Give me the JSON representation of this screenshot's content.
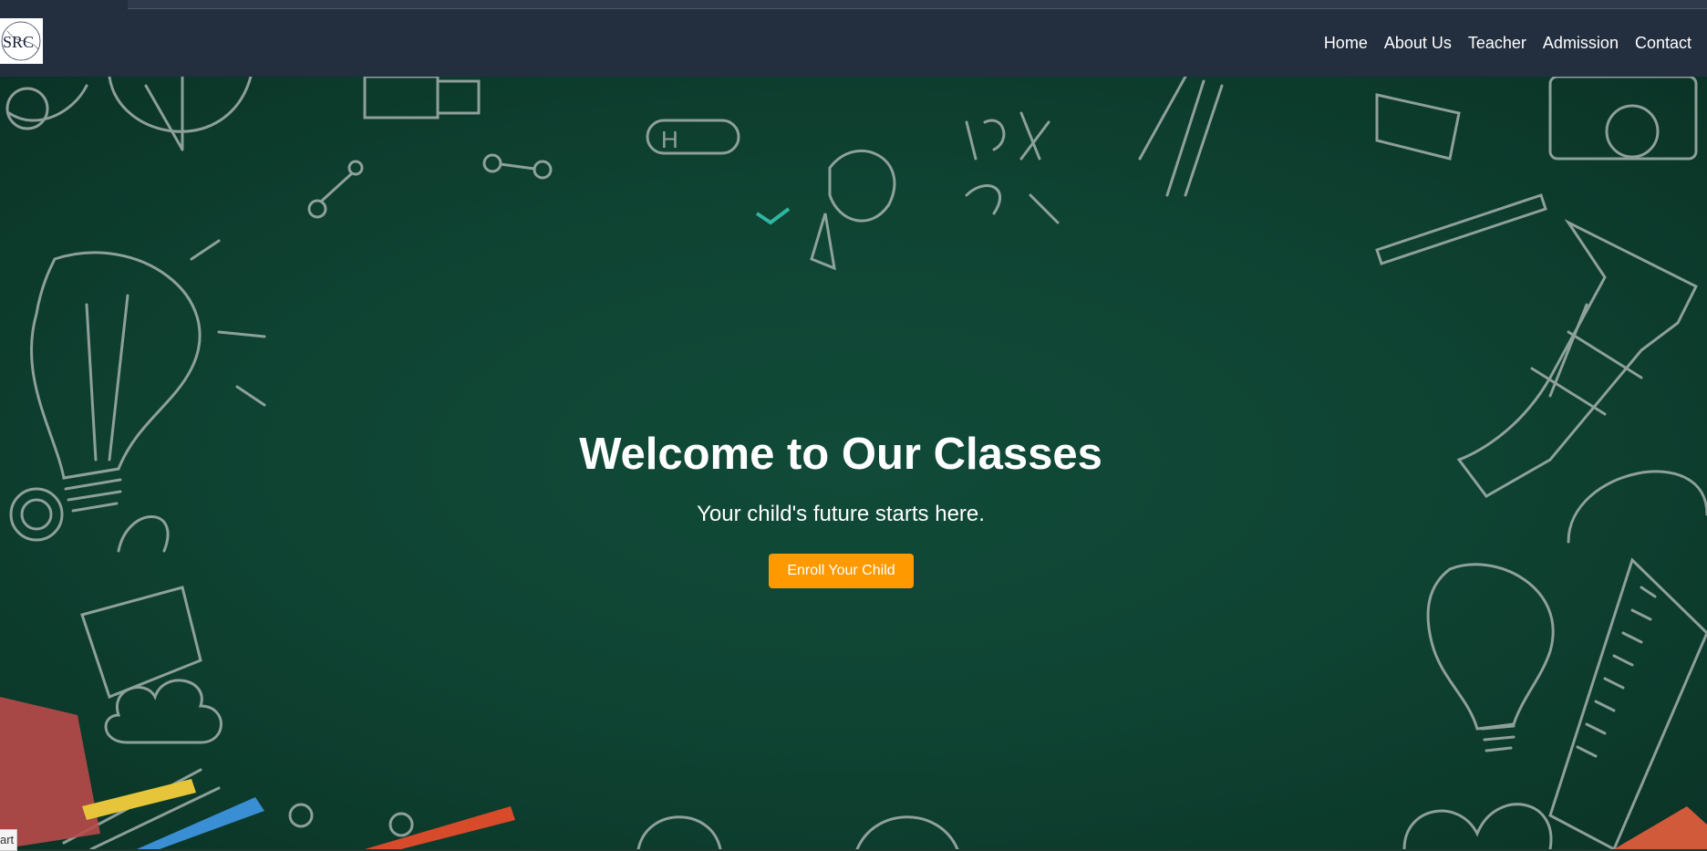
{
  "logo": {
    "text": "SRC"
  },
  "nav": {
    "items": [
      {
        "label": "Home"
      },
      {
        "label": "About Us"
      },
      {
        "label": "Teacher"
      },
      {
        "label": "Admission"
      },
      {
        "label": "Contact"
      }
    ]
  },
  "hero": {
    "title": "Welcome to Our Classes",
    "subtitle": "Your child's future starts here.",
    "cta_label": "Enroll Your Child"
  },
  "status": {
    "text": "art"
  },
  "colors": {
    "navbar": "#232e3f",
    "chalkboard": "#0f4433",
    "cta": "#ff9900",
    "text": "#ffffff"
  }
}
